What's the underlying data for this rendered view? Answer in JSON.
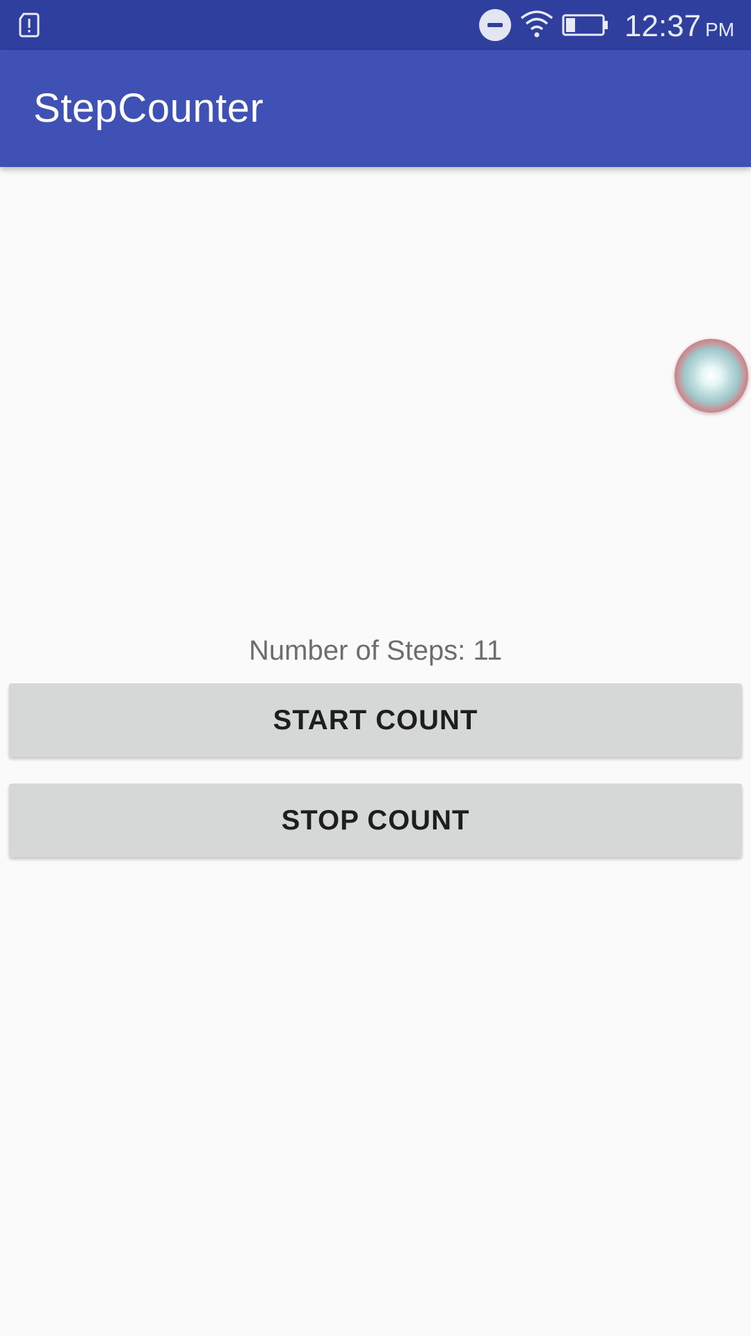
{
  "status_bar": {
    "time": "12:37",
    "ampm": "PM",
    "icons": [
      "sim-alert-icon",
      "do-not-disturb-icon",
      "wifi-icon",
      "battery-icon"
    ]
  },
  "app_bar": {
    "title": "StepCounter"
  },
  "main": {
    "steps_text": "Number of Steps: 11",
    "start_button_label": "START COUNT",
    "stop_button_label": "STOP COUNT"
  },
  "colors": {
    "status_bar": "#2f3f9e",
    "app_bar": "#3f51b5",
    "background": "#fafafa",
    "button": "#d6d7d7"
  }
}
